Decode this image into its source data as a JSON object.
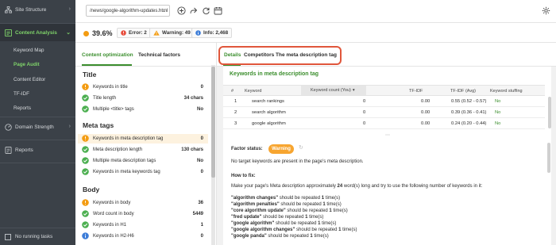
{
  "sidebar": {
    "items": [
      {
        "label": "Site Structure",
        "icon": "sitemap-icon"
      },
      {
        "label": "Content Analysis",
        "icon": "content-icon",
        "active": true
      },
      {
        "label": "Domain Strength",
        "icon": "gauge-icon"
      },
      {
        "label": "Reports",
        "icon": "reports-icon"
      }
    ],
    "sub_items": [
      "Keyword Map",
      "Page Audit",
      "Content Editor",
      "TF-IDF",
      "Reports"
    ],
    "active_sub": "Page Audit",
    "footer": "No running tasks"
  },
  "toolbar": {
    "url": "/news/google-algorithm-updates.html",
    "icons": [
      "add-icon",
      "share-icon",
      "refresh-icon",
      "calendar-icon",
      "settings-icon"
    ]
  },
  "scorebar": {
    "score": "39.6%",
    "error": "Error: 2",
    "warning": "Warning: 49",
    "info": "Info: 2,468",
    "colors": {
      "score_dot": "#f39c12",
      "error": "#e74c3c",
      "warning": "#f39c12",
      "info": "#3d7dd8"
    }
  },
  "left_panel": {
    "tabs": [
      "Content optimization",
      "Technical factors"
    ],
    "active_tab": "Content optimization",
    "groups": [
      {
        "title": "Title",
        "factors": [
          {
            "label": "Keywords in title",
            "value": "0",
            "status": "warning"
          },
          {
            "label": "Title length",
            "value": "34 chars",
            "status": "ok"
          },
          {
            "label": "Multiple <title> tags",
            "value": "No",
            "status": "ok"
          }
        ]
      },
      {
        "title": "Meta tags",
        "factors": [
          {
            "label": "Keywords in meta description tag",
            "value": "0",
            "status": "warning",
            "highlighted": true
          },
          {
            "label": "Meta description length",
            "value": "130 chars",
            "status": "ok"
          },
          {
            "label": "Multiple meta description tags",
            "value": "No",
            "status": "ok"
          },
          {
            "label": "Keywords in meta keywords tag",
            "value": "0",
            "status": "ok"
          }
        ]
      },
      {
        "title": "Body",
        "factors": [
          {
            "label": "Keywords in body",
            "value": "36",
            "status": "warning"
          },
          {
            "label": "Word count in body",
            "value": "5449",
            "status": "ok"
          },
          {
            "label": "Keywords in H1",
            "value": "1",
            "status": "ok"
          },
          {
            "label": "Keywords in H2-H6",
            "value": "0",
            "status": "info"
          }
        ]
      }
    ]
  },
  "right_panel": {
    "tabs": [
      "Details",
      "Competitors",
      "The meta description tag"
    ],
    "active_tab": "Details",
    "table": {
      "title": "Keywords in meta description tag",
      "columns": [
        "#",
        "Keyword",
        "Keyword count (You)",
        "TF-IDF",
        "TF-IDF (Avg)",
        "Keyword stuffing"
      ],
      "rows": [
        {
          "num": "1",
          "keyword": "search rankings",
          "count": "0",
          "tfidf": "0.00",
          "avg": "0.55 (0.52 - 0.57)",
          "stuffing": "No"
        },
        {
          "num": "2",
          "keyword": "search algorithm",
          "count": "0",
          "tfidf": "0.00",
          "avg": "0.39 (0.36 - 0.41)",
          "stuffing": "No"
        },
        {
          "num": "3",
          "keyword": "google algorithm",
          "count": "0",
          "tfidf": "0.00",
          "avg": "0.24 (0.20 - 0.44)",
          "stuffing": "No"
        }
      ]
    },
    "detail": {
      "factor_status_label": "Factor status:",
      "status": "Warning",
      "message": "No target keywords are present in the page's meta description.",
      "how_to_fix": "How to fix:",
      "instruction_pre": "Make your page's Meta description approximately ",
      "instruction_num": "24",
      "instruction_post": " word(s) long and try to use the following number of keywords in it:",
      "keywords": [
        {
          "kw": "\"algorithm changes\"",
          "text": " should be repeated ",
          "n": "1",
          "unit": " time(s)"
        },
        {
          "kw": "\"algorithm penalties\"",
          "text": " should be repeated ",
          "n": "1",
          "unit": " time(s)"
        },
        {
          "kw": "\"core algorithm update\"",
          "text": " should be repeated ",
          "n": "1",
          "unit": " time(s)"
        },
        {
          "kw": "\"fred update\"",
          "text": " should be repeated ",
          "n": "1",
          "unit": " time(s)"
        },
        {
          "kw": "\"google algorithm\"",
          "text": " should be repeated ",
          "n": "1",
          "unit": " time(s)"
        },
        {
          "kw": "\"google algorithm changes\"",
          "text": " should be repeated ",
          "n": "1",
          "unit": " time(s)"
        },
        {
          "kw": "\"google panda\"",
          "text": " should be repeated ",
          "n": "1",
          "unit": " time(s)"
        }
      ]
    }
  }
}
